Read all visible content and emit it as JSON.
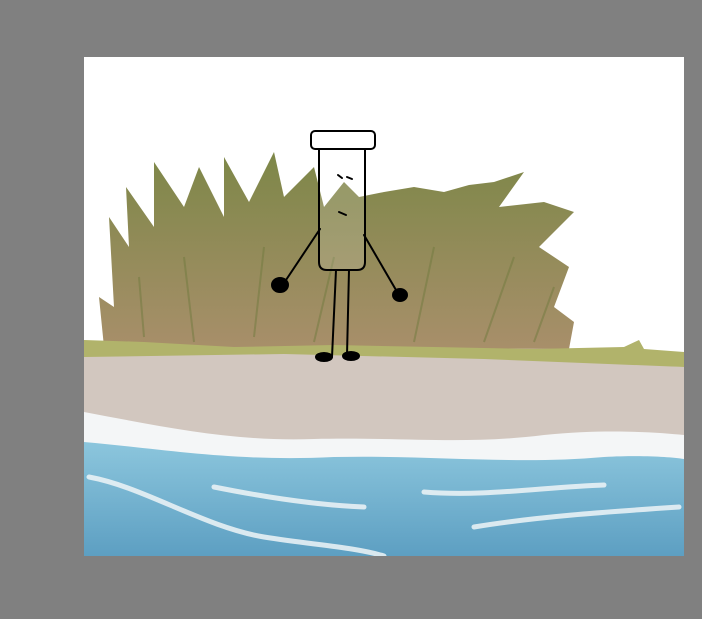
{
  "workspace": {
    "background_color": "#808080"
  },
  "artwork": {
    "colors": {
      "sky": "#ffffff",
      "bush_top": "#7d8748",
      "bush_bottom": "#a88f6a",
      "grass": "#b1b36b",
      "sand": "#d2c7bf",
      "foam": "#f4f6f7",
      "water_light": "#8cc6dd",
      "water_dark": "#5d9fc2",
      "ink": "#000000"
    }
  }
}
